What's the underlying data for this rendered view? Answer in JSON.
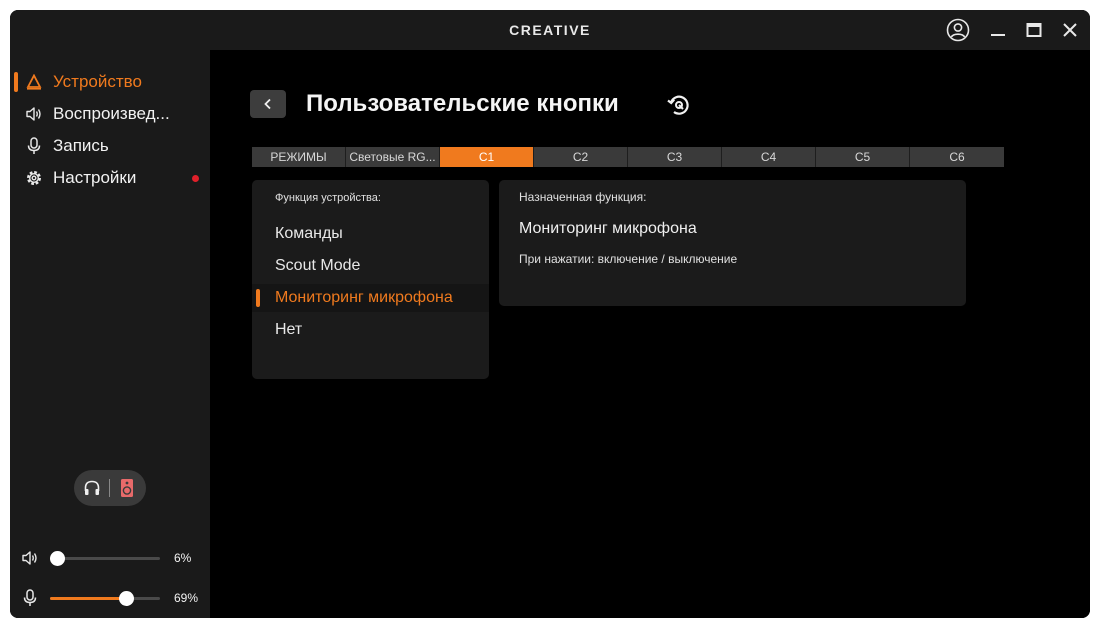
{
  "app": {
    "brand": "CREATIVE"
  },
  "sidebar": {
    "items": [
      {
        "label": "Устройство",
        "icon": "device-icon",
        "active": true
      },
      {
        "label": "Воспроизвед...",
        "icon": "speaker-icon",
        "active": false
      },
      {
        "label": "Запись",
        "icon": "microphone-icon",
        "active": false
      },
      {
        "label": "Настройки",
        "icon": "gear-icon",
        "active": false,
        "notification": true
      }
    ],
    "output_toggle": {
      "left_icon": "headphones-icon",
      "right_icon": "speakers-icon"
    },
    "volume": {
      "playback": {
        "value": 6,
        "label": "6%"
      },
      "recording": {
        "value": 69,
        "label": "69%"
      }
    }
  },
  "main": {
    "title": "Пользовательские кнопки",
    "tabs": [
      {
        "label": "РЕЖИМЫ",
        "active": false
      },
      {
        "label": "Световые RG...",
        "active": false
      },
      {
        "label": "C1",
        "active": true
      },
      {
        "label": "C2",
        "active": false
      },
      {
        "label": "C3",
        "active": false
      },
      {
        "label": "C4",
        "active": false
      },
      {
        "label": "C5",
        "active": false
      },
      {
        "label": "C6",
        "active": false
      }
    ],
    "device_functions": {
      "label": "Функция устройства:",
      "items": [
        {
          "label": "Команды",
          "selected": false
        },
        {
          "label": "Scout Mode",
          "selected": false
        },
        {
          "label": "Мониторинг микрофона",
          "selected": true
        },
        {
          "label": "Нет",
          "selected": false
        }
      ]
    },
    "assigned": {
      "label": "Назначенная функция:",
      "name": "Мониторинг микрофона",
      "description": "При нажатии: включение / выключение"
    }
  },
  "colors": {
    "accent": "#f07a1e",
    "notification": "#e0202a",
    "speaker_accent": "#e86a6a"
  }
}
